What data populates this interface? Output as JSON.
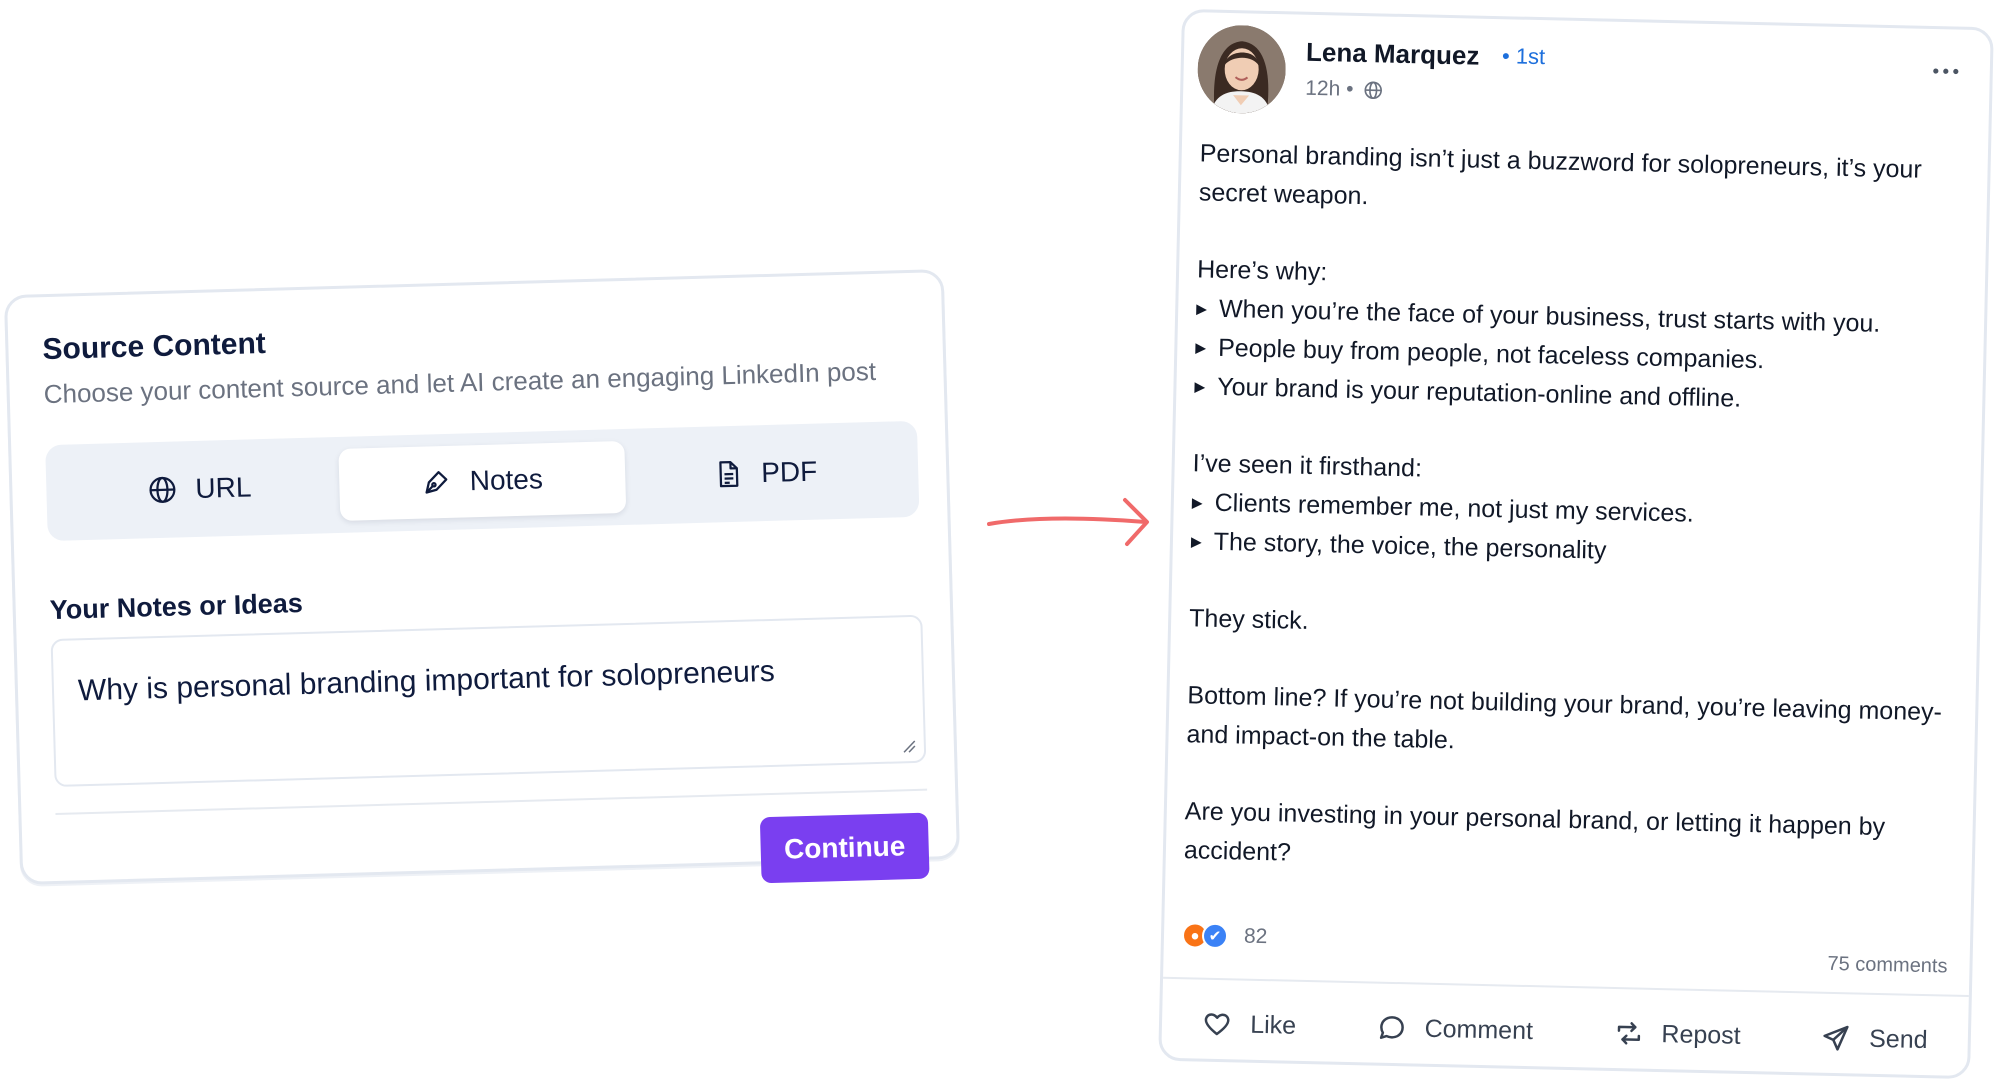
{
  "source": {
    "title": "Source Content",
    "subtitle": "Choose your content source and let AI create an engaging LinkedIn post",
    "tabs": [
      {
        "label": "URL",
        "icon": "globe-icon"
      },
      {
        "label": "Notes",
        "icon": "pen-icon",
        "selected": true
      },
      {
        "label": "PDF",
        "icon": "document-icon"
      }
    ],
    "notes_label": "Your Notes or Ideas",
    "notes_value": "Why is personal branding important for solopreneurs",
    "continue_label": "Continue",
    "accent_color": "#7a3ff0"
  },
  "post": {
    "author": "Lena Marquez",
    "degree": "• 1st",
    "time": "12h •",
    "intro": "Personal branding isn’t just a buzzword for solopreneurs, it’s your secret weapon.",
    "why_heading": "Here’s why:",
    "why_bullets": [
      "When you’re the face of your business, trust starts with you.",
      "People buy from people, not faceless companies.",
      "Your brand is your reputation-online and offline."
    ],
    "seen_heading": "I’ve seen it firsthand:",
    "seen_bullets": [
      "Clients remember me, not just my services.",
      "The story, the voice, the personality"
    ],
    "stick": "They stick.",
    "bottom_line": "Bottom line? If you’re not building your brand, you’re leaving money-and impact-on the table.",
    "question": "Are you investing in your personal brand, or letting it happen by accident?",
    "reaction_count": "82",
    "comments": "75 comments",
    "actions": {
      "like": "Like",
      "comment": "Comment",
      "repost": "Repost",
      "send": "Send"
    },
    "link_color": "#1d6fdc"
  }
}
